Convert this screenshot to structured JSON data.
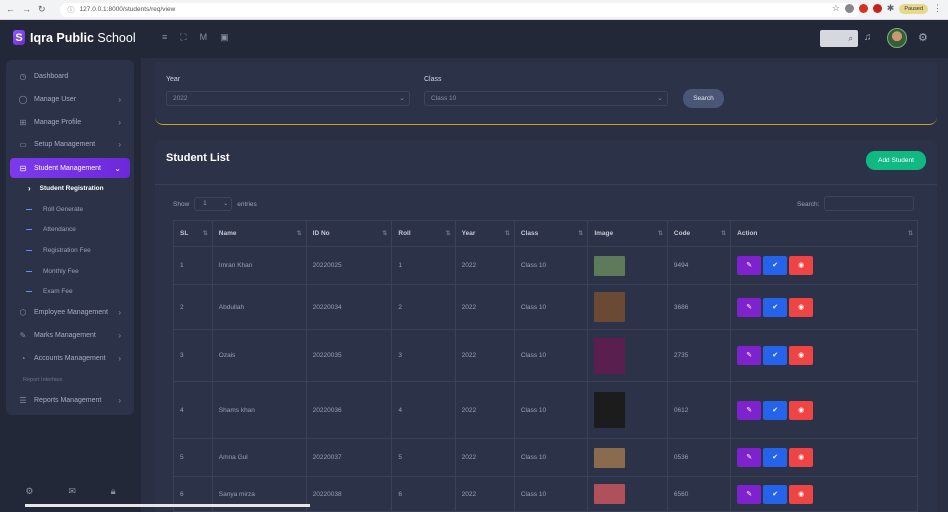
{
  "browser": {
    "url": "127.0.0.1:8000/students/req/view",
    "profile_label": "Paused"
  },
  "header": {
    "brand_bold": "Iqra Public",
    "brand_rest": "School"
  },
  "sidebar": {
    "items": [
      {
        "label": "Dashboard",
        "icon": "clock-icon"
      },
      {
        "label": "Manage User",
        "icon": "user-icon"
      },
      {
        "label": "Manage Profile",
        "icon": "grid-icon"
      },
      {
        "label": "Setup Management",
        "icon": "monitor-icon"
      },
      {
        "label": "Student Management",
        "icon": "archive-icon"
      }
    ],
    "subitems": [
      {
        "label": "Student Registration"
      },
      {
        "label": "Roll Generate"
      },
      {
        "label": "Attendance"
      },
      {
        "label": "Registration Fee"
      },
      {
        "label": "Monthly Fee"
      },
      {
        "label": "Exam Fee"
      }
    ],
    "items2": [
      {
        "label": "Employee Management",
        "icon": "box-icon"
      },
      {
        "label": "Marks Management",
        "icon": "pencil-icon"
      },
      {
        "label": "Accounts Management",
        "icon": "pie-icon"
      }
    ],
    "section_label": "Report Interface",
    "reports": {
      "label": "Reports Management",
      "icon": "server-icon"
    }
  },
  "filter": {
    "year_label": "Year",
    "year_value": "2022",
    "class_label": "Class",
    "class_value": "Class 10",
    "search_button": "Search"
  },
  "list": {
    "title": "Student List",
    "add_button": "Add Student",
    "show_prefix": "Show",
    "show_value": "1",
    "show_suffix": "entries",
    "search_label": "Search:",
    "columns": [
      "SL",
      "Name",
      "ID No",
      "Roll",
      "Year",
      "Class",
      "Image",
      "Code",
      "Action"
    ],
    "rows": [
      {
        "sl": "1",
        "name": "Imran Khan",
        "id": "20220025",
        "roll": "1",
        "year": "2022",
        "class": "Class 10",
        "code": "9494",
        "img": "#5d7a5a"
      },
      {
        "sl": "2",
        "name": "Abdullah",
        "id": "20220034",
        "roll": "2",
        "year": "2022",
        "class": "Class 10",
        "code": "3686",
        "img": "#6b4a35"
      },
      {
        "sl": "3",
        "name": "Ozais",
        "id": "20220035",
        "roll": "3",
        "year": "2022",
        "class": "Class 10",
        "code": "2735",
        "img": "#5a1f4e"
      },
      {
        "sl": "4",
        "name": "Shams khan",
        "id": "20220036",
        "roll": "4",
        "year": "2022",
        "class": "Class 10",
        "code": "0612",
        "img": "#1c1c1c"
      },
      {
        "sl": "5",
        "name": "Amna Gul",
        "id": "20220037",
        "roll": "5",
        "year": "2022",
        "class": "Class 10",
        "code": "0536",
        "img": "#8a6b4d"
      },
      {
        "sl": "6",
        "name": "Sanya mirza",
        "id": "20220038",
        "roll": "6",
        "year": "2022",
        "class": "Class 10",
        "code": "6560",
        "img": "#b0505a"
      }
    ]
  }
}
